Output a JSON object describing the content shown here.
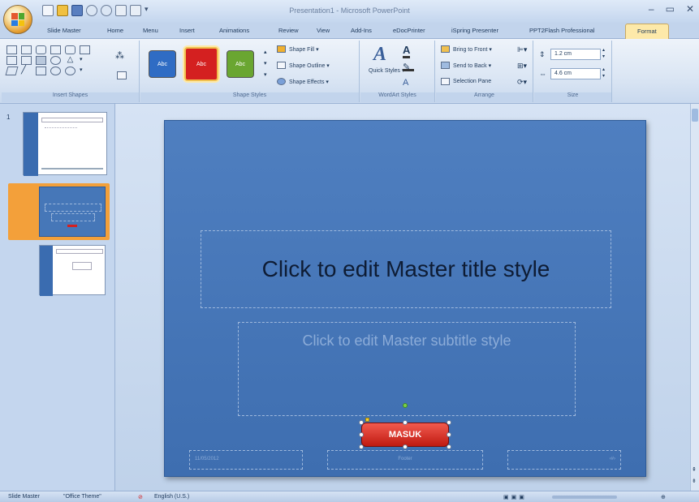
{
  "window": {
    "title": "Presentation1 - Microsoft PowerPoint",
    "minimize": "–",
    "maximize": "▭",
    "close": "✕"
  },
  "tabs": [
    {
      "label": "Slide Master",
      "active": false
    },
    {
      "label": "Home",
      "active": false
    },
    {
      "label": "Menu",
      "active": false
    },
    {
      "label": "Insert",
      "active": false
    },
    {
      "label": "Animations",
      "active": false
    },
    {
      "label": "Review",
      "active": false
    },
    {
      "label": "View",
      "active": false
    },
    {
      "label": "Add-Ins",
      "active": false
    },
    {
      "label": "eDocPrinter",
      "active": false
    },
    {
      "label": "iSpring Presenter",
      "active": false
    },
    {
      "label": "PPT2Flash Professional",
      "active": false
    },
    {
      "label": "Format",
      "active": true
    }
  ],
  "ribbon": {
    "insert_shapes": {
      "label": "Insert Shapes"
    },
    "shape_styles": {
      "label": "Shape Styles",
      "presets": [
        {
          "text": "Abc",
          "color": "#2f6cc4"
        },
        {
          "text": "Abc",
          "color": "#d42020"
        },
        {
          "text": "Abc",
          "color": "#6aa631"
        }
      ],
      "shape_fill": "Shape Fill ▾",
      "shape_outline": "Shape Outline ▾",
      "shape_effects": "Shape Effects ▾"
    },
    "wordart_styles": {
      "label": "WordArt Styles",
      "quick_styles": "Quick Styles ▾"
    },
    "arrange": {
      "label": "Arrange",
      "bring_to_front": "Bring to Front ▾",
      "send_to_back": "Send to Back ▾",
      "selection_pane": "Selection Pane"
    },
    "size": {
      "label": "Size",
      "height": "1.2 cm",
      "width": "4.6 cm"
    }
  },
  "slide": {
    "title": "Click to edit Master title style",
    "subtitle": "Click to edit Master subtitle style",
    "button_text": "MASUK",
    "footer_left": "11/05/2012",
    "footer_center": "Footer",
    "footer_right": "‹#›"
  },
  "thumbnails": [
    {
      "number": "1",
      "selected": false
    },
    {
      "number": "",
      "selected": true
    },
    {
      "number": "",
      "selected": false
    }
  ],
  "status": {
    "view": "Slide Master",
    "theme": "\"Office Theme\"",
    "language": "English (U.S.)"
  },
  "colors": {
    "accent": "#fde9a9",
    "slide_bg": "#3e6eb0",
    "button": "#d42020"
  }
}
